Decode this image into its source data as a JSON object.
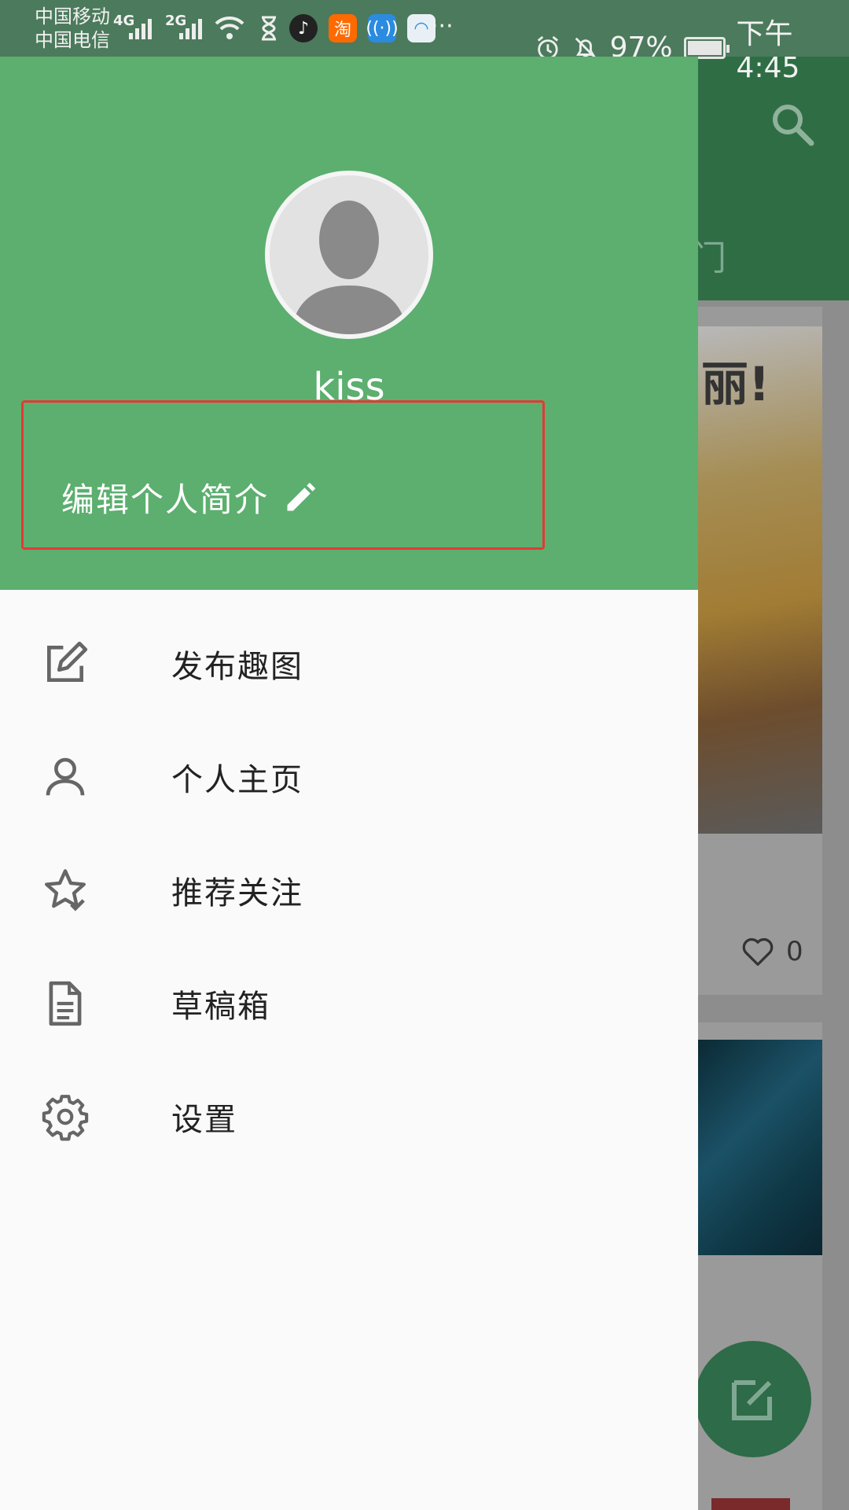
{
  "status_bar": {
    "carrier_1": "中国移动",
    "carrier_2": "中国电信",
    "network_1": "4G",
    "network_2": "2G",
    "more": "···",
    "battery": "97%",
    "time": "下午4:45"
  },
  "drawer": {
    "username": "kiss",
    "edit_bio_label": "编辑个人简介",
    "menu": [
      {
        "label": "发布趣图",
        "icon": "edit-square-icon"
      },
      {
        "label": "个人主页",
        "icon": "person-icon"
      },
      {
        "label": "推荐关注",
        "icon": "star-check-icon"
      },
      {
        "label": "草稿箱",
        "icon": "document-icon"
      },
      {
        "label": "设置",
        "icon": "gear-icon"
      }
    ]
  },
  "background": {
    "tab_fragment": "门",
    "card_text": "丽!",
    "like_count": "0"
  },
  "colors": {
    "header_green": "#5caf6f",
    "status_bar": "#4c7a5c",
    "highlight_red": "#e53935"
  }
}
